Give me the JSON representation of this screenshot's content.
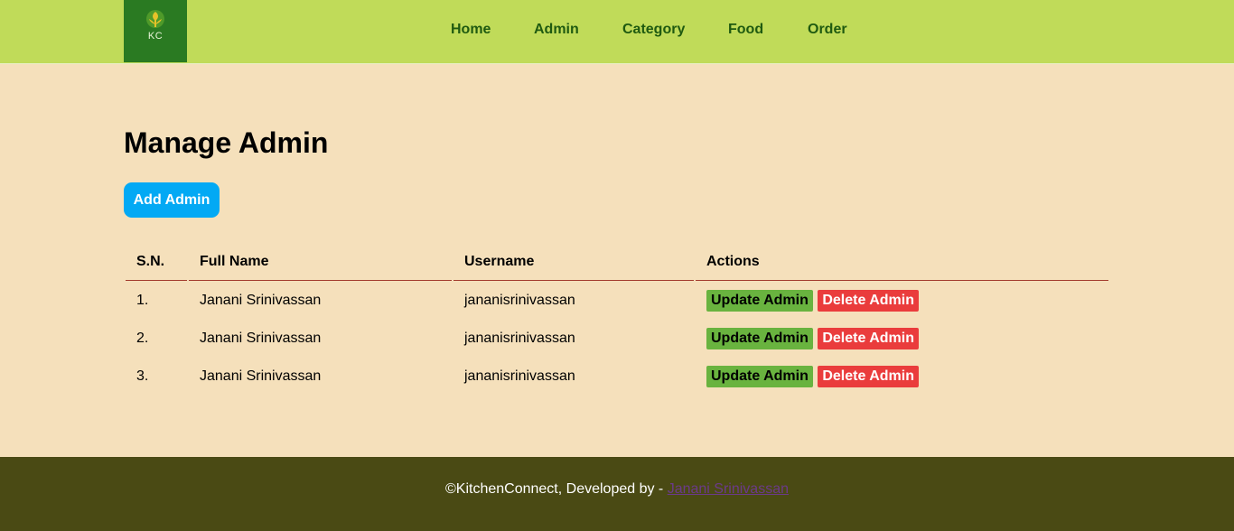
{
  "logo": {
    "text": "KC"
  },
  "nav": {
    "items": [
      {
        "label": "Home"
      },
      {
        "label": "Admin"
      },
      {
        "label": "Category"
      },
      {
        "label": "Food"
      },
      {
        "label": "Order"
      }
    ]
  },
  "page": {
    "title": "Manage Admin",
    "add_button": "Add Admin"
  },
  "table": {
    "headers": [
      "S.N.",
      "Full Name",
      "Username",
      "Actions"
    ],
    "rows": [
      {
        "sn": "1.",
        "full_name": "Janani Srinivassan",
        "username": "jananisrinivassan",
        "update": "Update Admin",
        "delete": "Delete Admin"
      },
      {
        "sn": "2.",
        "full_name": "Janani Srinivassan",
        "username": "jananisrinivassan",
        "update": "Update Admin",
        "delete": "Delete Admin"
      },
      {
        "sn": "3.",
        "full_name": "Janani Srinivassan",
        "username": "jananisrinivassan",
        "update": "Update Admin",
        "delete": "Delete Admin"
      }
    ]
  },
  "footer": {
    "text": "©KitchenConnect, Developed by - ",
    "link": "Janani Srinivassan"
  },
  "colors": {
    "navbar": "#c0db59",
    "logo_bg": "#2a7a22",
    "background": "#f5e0bb",
    "add_button": "#03a9f4",
    "update_button": "#69b33f",
    "delete_button": "#ea3c3c",
    "footer": "#4a4a14"
  }
}
